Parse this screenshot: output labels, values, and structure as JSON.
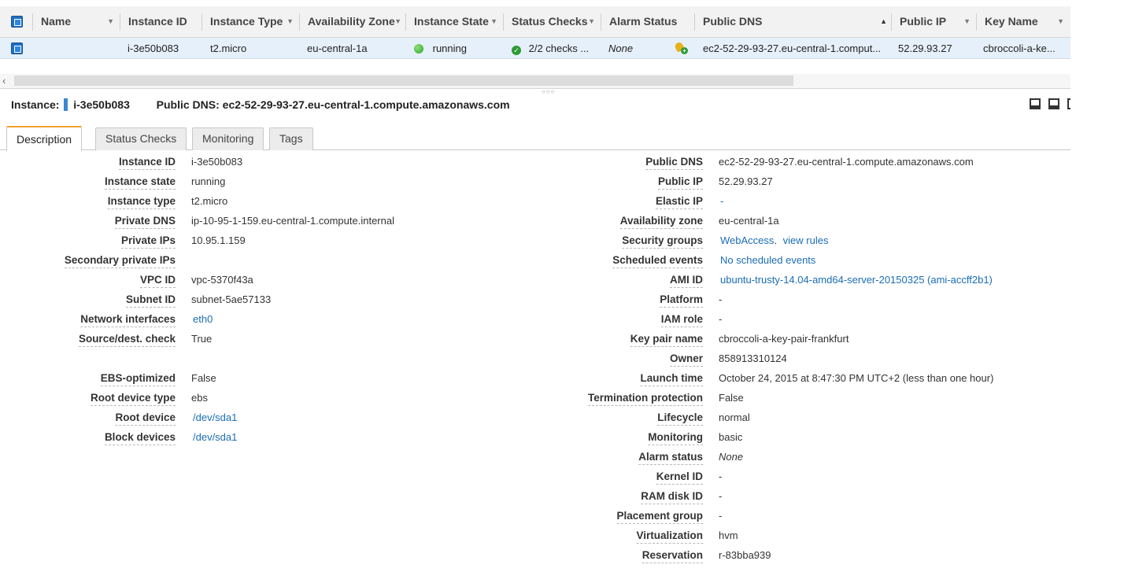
{
  "table": {
    "columns": [
      "Name",
      "Instance ID",
      "Instance Type",
      "Availability Zone",
      "Instance State",
      "Status Checks",
      "Alarm Status",
      "Public DNS",
      "Public IP",
      "Key Name"
    ],
    "row": {
      "name": "",
      "instance_id": "i-3e50b083",
      "instance_type": "t2.micro",
      "availability_zone": "eu-central-1a",
      "instance_state": "running",
      "status_checks": "2/2 checks ...",
      "alarm_status": "None",
      "public_dns": "ec2-52-29-93-27.eu-central-1.comput...",
      "public_ip": "52.29.93.27",
      "key_name": "cbroccoli-a-ke..."
    }
  },
  "detail_header": {
    "instance_label": "Instance:",
    "instance_id": "i-3e50b083",
    "dns_label": "Public DNS:",
    "dns": "ec2-52-29-93-27.eu-central-1.compute.amazonaws.com"
  },
  "tabs": [
    "Description",
    "Status Checks",
    "Monitoring",
    "Tags"
  ],
  "left_fields": [
    {
      "label": "Instance ID",
      "value": "i-3e50b083"
    },
    {
      "label": "Instance state",
      "value": "running"
    },
    {
      "label": "Instance type",
      "value": "t2.micro"
    },
    {
      "label": "Private DNS",
      "value": "ip-10-95-1-159.eu-central-1.compute.internal"
    },
    {
      "label": "Private IPs",
      "value": "10.95.1.159"
    },
    {
      "label": "Secondary private IPs",
      "value": ""
    },
    {
      "label": "VPC ID",
      "value": "vpc-5370f43a"
    },
    {
      "label": "Subnet ID",
      "value": "subnet-5ae57133"
    },
    {
      "label": "Network interfaces",
      "value": "eth0"
    },
    {
      "label": "Source/dest. check",
      "value": "True"
    },
    {
      "label": "EBS-optimized",
      "value": "False"
    },
    {
      "label": "Root device type",
      "value": "ebs"
    },
    {
      "label": "Root device",
      "value": "/dev/sda1"
    },
    {
      "label": "Block devices",
      "value": "/dev/sda1"
    }
  ],
  "right_fields": [
    {
      "label": "Public DNS",
      "value": "ec2-52-29-93-27.eu-central-1.compute.amazonaws.com"
    },
    {
      "label": "Public IP",
      "value": "52.29.93.27"
    },
    {
      "label": "Elastic IP",
      "value": "-"
    },
    {
      "label": "Availability zone",
      "value": "eu-central-1a"
    },
    {
      "label": "Security groups",
      "value": "WebAccess",
      "value2": "view rules",
      "sep": "."
    },
    {
      "label": "Scheduled events",
      "value": "No scheduled events"
    },
    {
      "label": "AMI ID",
      "value": "ubuntu-trusty-14.04-amd64-server-20150325 (ami-accff2b1)"
    },
    {
      "label": "Platform",
      "value": "-"
    },
    {
      "label": "IAM role",
      "value": "-"
    },
    {
      "label": "Key pair name",
      "value": "cbroccoli-a-key-pair-frankfurt"
    },
    {
      "label": "Owner",
      "value": "858913310124"
    },
    {
      "label": "Launch time",
      "value": "October 24, 2015 at 8:47:30 PM UTC+2 (less than one hour)"
    },
    {
      "label": "Termination protection",
      "value": "False"
    },
    {
      "label": "Lifecycle",
      "value": "normal"
    },
    {
      "label": "Monitoring",
      "value": "basic"
    },
    {
      "label": "Alarm status",
      "value": "None"
    },
    {
      "label": "Kernel ID",
      "value": "-"
    },
    {
      "label": "RAM disk ID",
      "value": "-"
    },
    {
      "label": "Placement group",
      "value": "-"
    },
    {
      "label": "Virtualization",
      "value": "hvm"
    },
    {
      "label": "Reservation",
      "value": "r-83bba939"
    }
  ],
  "colors": {
    "accent_link": "#1a6db5",
    "selected_row": "#e6f0fa",
    "running_green": "#2ea32a",
    "active_tab_top": "#f0a030"
  }
}
